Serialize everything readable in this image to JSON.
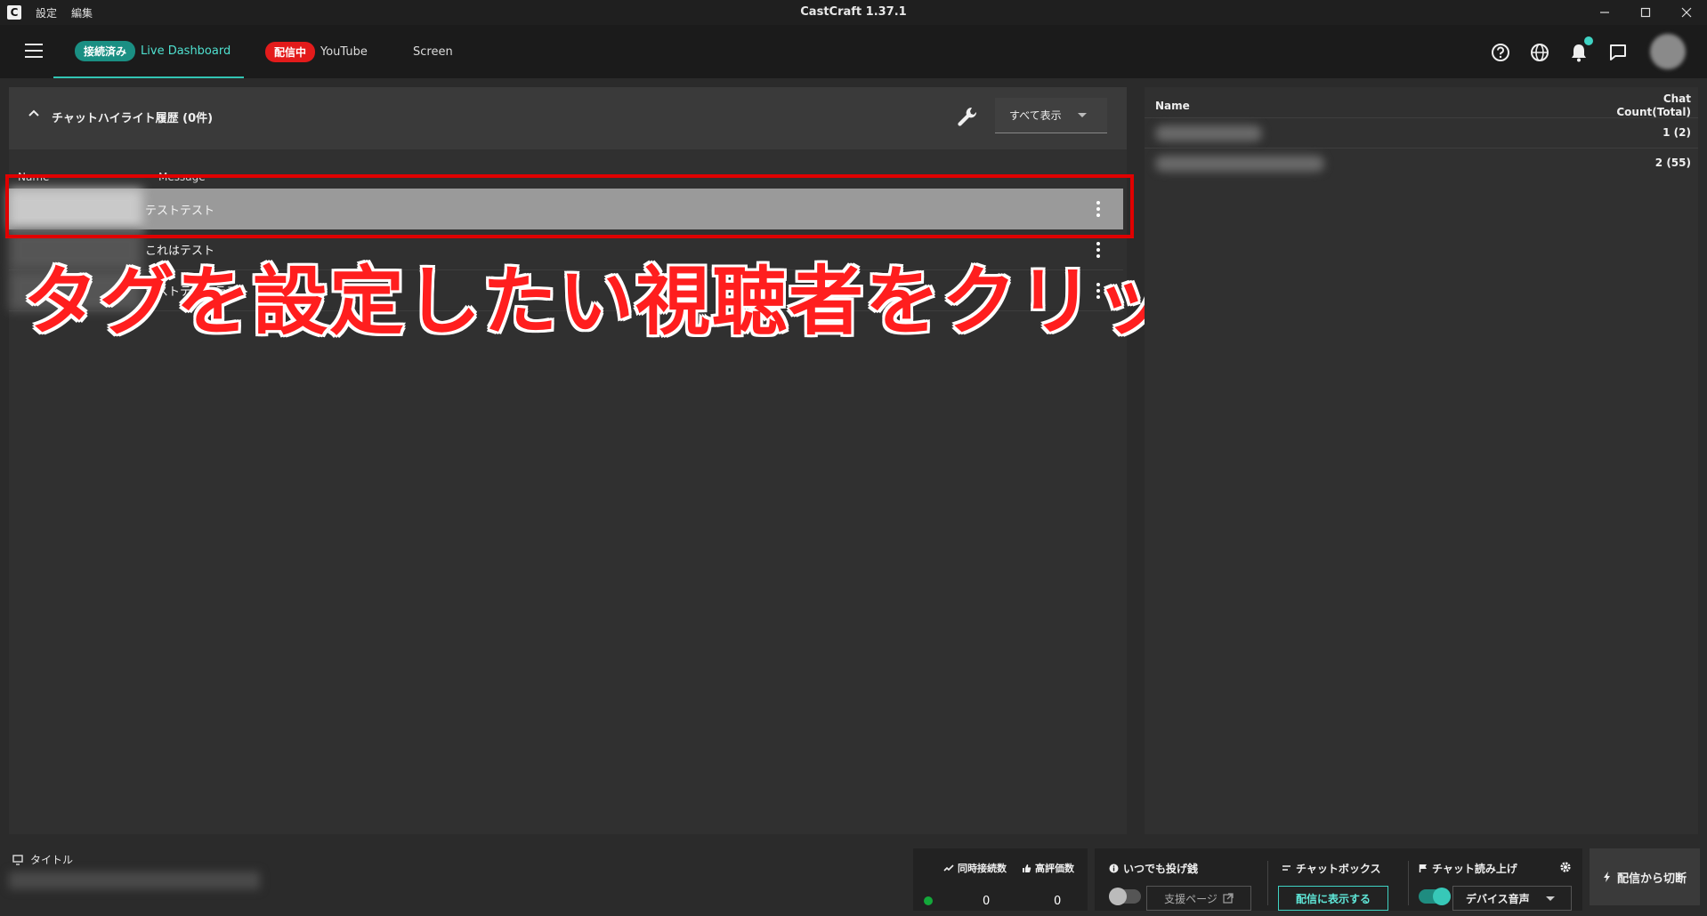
{
  "titlebar": {
    "logo": "C",
    "menu": [
      "設定",
      "編集"
    ],
    "title": "CastCraft 1.37.1",
    "controls": [
      "minimize-icon",
      "maximize-icon",
      "close-icon"
    ]
  },
  "header": {
    "tabs": [
      {
        "badge": "接続済み",
        "label": "Live Dashboard",
        "active": true
      },
      {
        "badge": "配信中",
        "label": "YouTube"
      },
      {
        "label": "Screen"
      }
    ],
    "icons": [
      "help-icon",
      "globe-icon",
      "bell-icon",
      "chat-icon"
    ],
    "accent": "#32c4b3"
  },
  "left": {
    "highlight_title": "チャットハイライト履歴 (0件)",
    "filter": "すべて表示",
    "columns": {
      "name": "Name",
      "message": "Message"
    },
    "rows": [
      {
        "message": "テストテスト",
        "selected": true
      },
      {
        "message": "これはテスト"
      },
      {
        "message": "テストテストテスト"
      }
    ]
  },
  "annotation": {
    "text": "タグを設定したい視聴者をクリック",
    "color": "#ff1e1e"
  },
  "right": {
    "col_name": "Name",
    "col_count_line1": "Chat",
    "col_count_line2": "Count(Total)",
    "rows": [
      {
        "count": "1 (2)"
      },
      {
        "count": "2 (55)"
      }
    ]
  },
  "bottom": {
    "title_label": "タイトル",
    "concurrent_label": "同時接続数",
    "likes_label": "高評価数",
    "concurrent": "0",
    "likes": "0",
    "tipping_label": "いつでも投げ銭",
    "support_page": "支援ページ",
    "chatbox_label": "チャットボックス",
    "show_on_stream": "配信に表示する",
    "tts_label": "チャット読み上げ",
    "device": "デバイス音声",
    "disconnect": "配信から切断"
  }
}
